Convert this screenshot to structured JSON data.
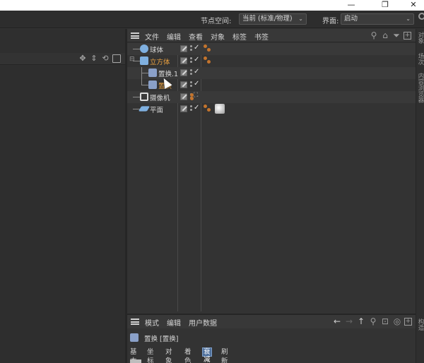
{
  "window": {
    "minimize": "—",
    "restore": "❐",
    "close": "✕"
  },
  "topbar": {
    "node_space_label": "节点空间:",
    "node_space_value": "当前 (标准/物理)",
    "layout_label": "界面:",
    "layout_value": "启动"
  },
  "viewport": {
    "toolbar_icons": [
      "move-icon",
      "up-down-icon",
      "rotate-view-icon",
      "layout-icon"
    ]
  },
  "object_manager": {
    "menu": [
      "文件",
      "编辑",
      "查看",
      "对象",
      "标签",
      "书签"
    ],
    "tools": [
      "search-icon",
      "home-icon",
      "filter-icon",
      "new-window-icon"
    ],
    "objects": [
      {
        "name": "球体",
        "icon": "sphere-icon",
        "icon_color": "#7fb0e0",
        "name_color": "#d8d8d8",
        "depth": 0,
        "tags": 1
      },
      {
        "name": "立方体",
        "icon": "cube-icon",
        "icon_color": "#7fb0e0",
        "name_color": "#e8a040",
        "depth": 0,
        "tags": 1,
        "expanded": true
      },
      {
        "name": "置换.1",
        "icon": "displacer-icon",
        "icon_color": "#8aa0c8",
        "name_color": "#d8d8d8",
        "depth": 1,
        "tags": 0
      },
      {
        "name": "置换",
        "icon": "displacer-icon",
        "icon_color": "#8aa0c8",
        "name_color": "#e8a040",
        "depth": 1,
        "tags": 0
      },
      {
        "name": "摄像机",
        "icon": "camera-icon",
        "icon_color": "#dddddd",
        "name_color": "#d8d8d8",
        "depth": 0,
        "tags": 0,
        "camera": true
      },
      {
        "name": "平面",
        "icon": "plane-icon",
        "icon_color": "#7fb0e0",
        "name_color": "#d8d8d8",
        "depth": 0,
        "tags": 1,
        "texture": true
      }
    ]
  },
  "attribute_manager": {
    "menu": [
      "模式",
      "编辑",
      "用户数据"
    ],
    "tools": [
      "back-arrow-icon",
      "forward-arrow-icon",
      "up-arrow-icon",
      "search-icon",
      "lock-icon",
      "target-icon",
      "new-window-icon"
    ],
    "object_line": "置换 [置换]",
    "tabs": [
      "基本",
      "坐标",
      "对象",
      "着色",
      "衰减",
      "刷新"
    ],
    "active_tab": "衰减"
  },
  "right_tabs": [
    "对象",
    "场次",
    "内容浏览器",
    "构造"
  ],
  "colors": {
    "accent": "#4d6f9c",
    "selected_text": "#e8a040",
    "tag_orange": "#c4742d"
  }
}
